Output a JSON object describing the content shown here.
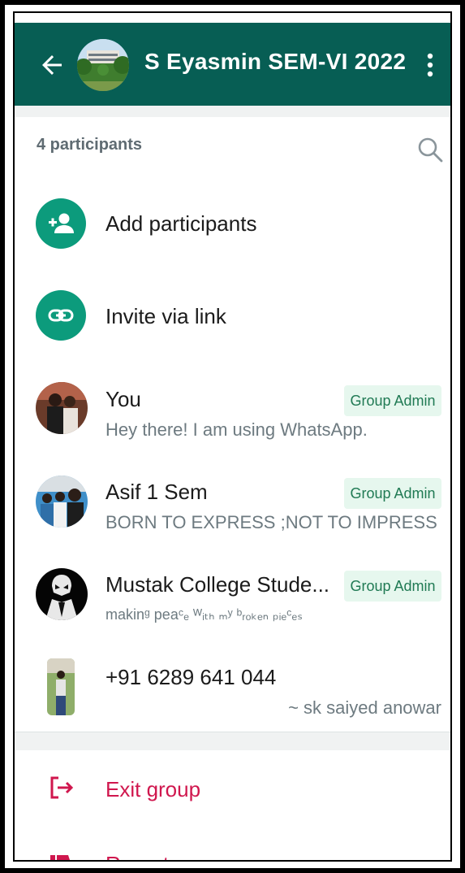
{
  "header": {
    "title": "S Eyasmin SEM-VI 2022",
    "back_icon": "arrow-left-icon",
    "menu_icon": "more-vert-icon"
  },
  "participants": {
    "count_label": "4 participants",
    "search_icon": "search-icon"
  },
  "actions": {
    "add_label": "Add participants",
    "invite_label": "Invite via link"
  },
  "members": [
    {
      "name": "You",
      "status": "Hey there! I am using WhatsApp.",
      "badge": "Group Admin"
    },
    {
      "name": "Asif 1 Sem",
      "status": "BORN TO EXPRESS ;NOT TO IMPRESS",
      "badge": "Group Admin"
    },
    {
      "name": "Mustak College Stude...",
      "status": "makinᵍ peaᶜₑ ᵂᵢₜₕ ₘʸ ᵇᵣₒₖₑₙ ₚᵢₑᶜₑₛ",
      "badge": "Group Admin"
    },
    {
      "name": "+91 6289 641 044",
      "alt_name": "~ sk saiyed anowar"
    }
  ],
  "footer": {
    "exit_label": "Exit group",
    "report_label": "Report group"
  },
  "colors": {
    "header_bg": "#075E54",
    "accent": "#0c9b7c",
    "danger": "#d0174e",
    "badge_bg": "#e6f7ee",
    "badge_text": "#207a54"
  }
}
